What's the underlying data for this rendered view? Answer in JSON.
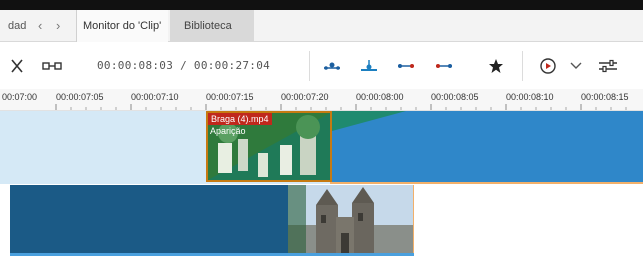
{
  "tabs": {
    "prev_partial": "dad",
    "monitor": "Monitor do 'Clip'",
    "library": "Biblioteca"
  },
  "toolbar": {
    "timecode": "00:00:08:03 / 00:00:27:04",
    "icons": [
      "cut-icon",
      "split-icon",
      "keyframe-add-icon",
      "keyframe-center-icon",
      "keyframe-prev-icon",
      "keyframe-next-icon",
      "favorite-star-icon",
      "play-mode-icon",
      "dropdown-chevron-icon",
      "settings-sliders-icon"
    ]
  },
  "ruler": {
    "labels": [
      "00:07:00",
      "00:00:07:05",
      "00:00:07:10",
      "00:00:07:15",
      "00:00:07:20",
      "00:00:08:00",
      "00:00:08:05",
      "00:00:08:10",
      "00:00:08:15"
    ]
  },
  "timeline": {
    "clip_name": "Braga (4).mp4",
    "clip_effect": "Aparição"
  },
  "colors": {
    "track_top_bg": "#d5e9f6",
    "track_clip_blue": "#2f87c9",
    "track_bottom_dark": "#1b5a86",
    "clip_label_red": "#c0281c",
    "clip_border": "#c67a12"
  }
}
